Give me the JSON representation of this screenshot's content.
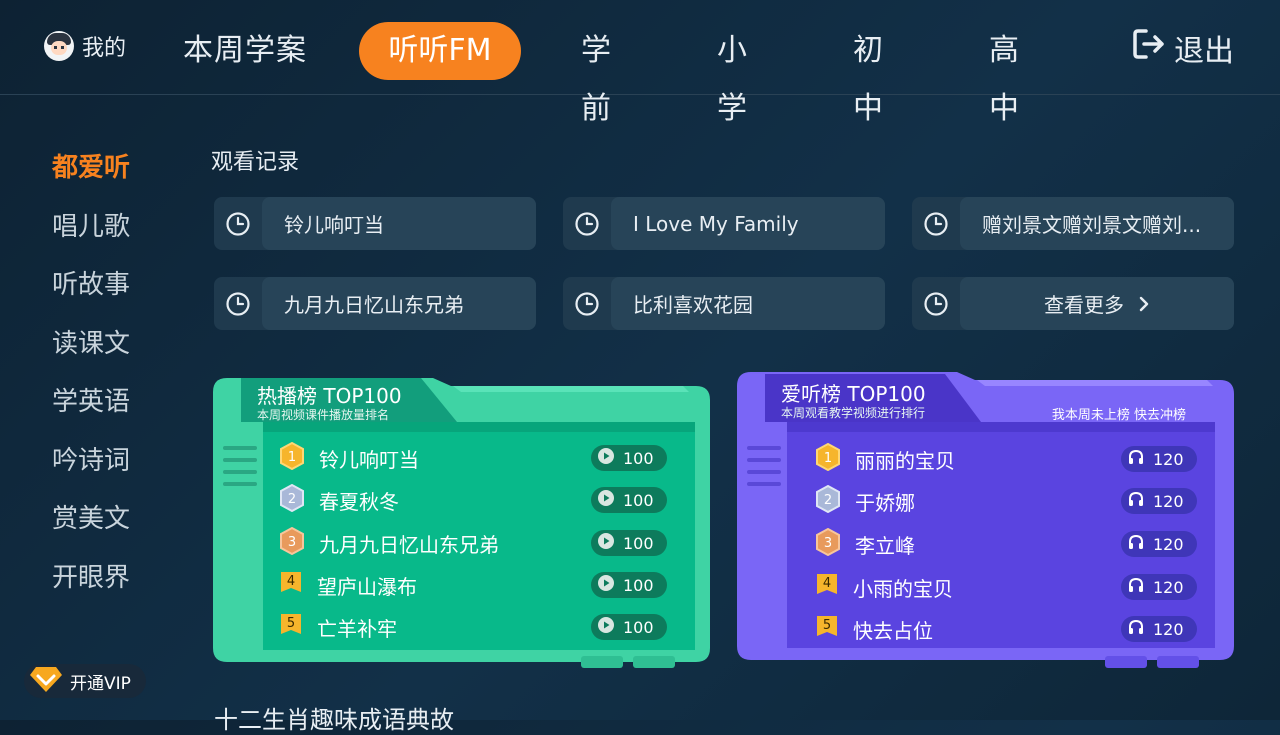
{
  "header": {
    "profile_label": "我的",
    "tabs": [
      {
        "label": "本周学案"
      },
      {
        "label": "听听FM"
      },
      {
        "label": "学前"
      },
      {
        "label": "小学"
      },
      {
        "label": "初中"
      },
      {
        "label": "高中"
      }
    ],
    "active_tab": "听听FM",
    "logout_label": "退出"
  },
  "sidebar": {
    "items": [
      {
        "label": "都爱听"
      },
      {
        "label": "唱儿歌"
      },
      {
        "label": "听故事"
      },
      {
        "label": "读课文"
      },
      {
        "label": "学英语"
      },
      {
        "label": "吟诗词"
      },
      {
        "label": "赏美文"
      },
      {
        "label": "开眼界"
      }
    ],
    "active_item": "都爱听"
  },
  "history": {
    "title": "观看记录",
    "items": [
      {
        "label": "铃儿响叮当"
      },
      {
        "label": "I Love My Family"
      },
      {
        "label": "赠刘景文赠刘景文赠刘..."
      },
      {
        "label": "九月九日忆山东兄弟"
      },
      {
        "label": "比利喜欢花园"
      }
    ],
    "more_label": "查看更多"
  },
  "hot_chart": {
    "title": "热播榜 TOP100",
    "subtitle": "本周视频课件播放量排名",
    "color": "#3dd4a6",
    "rows": [
      {
        "rank": "1",
        "name": "铃儿响叮当",
        "count": "100"
      },
      {
        "rank": "2",
        "name": "春夏秋冬",
        "count": "100"
      },
      {
        "rank": "3",
        "name": "九月九日忆山东兄弟",
        "count": "100"
      },
      {
        "rank": "4",
        "name": "望庐山瀑布",
        "count": "100"
      },
      {
        "rank": "5",
        "name": "亡羊补牢",
        "count": "100"
      }
    ]
  },
  "love_chart": {
    "title": "爱听榜 TOP100",
    "subtitle": "本周观看教学视频进行排行",
    "note": "我本周未上榜 快去冲榜",
    "color": "#7b66f5",
    "rows": [
      {
        "rank": "1",
        "name": "丽丽的宝贝",
        "count": "120"
      },
      {
        "rank": "2",
        "name": "于娇娜",
        "count": "120"
      },
      {
        "rank": "3",
        "name": "李立峰",
        "count": "120"
      },
      {
        "rank": "4",
        "name": "小雨的宝贝",
        "count": "120"
      },
      {
        "rank": "5",
        "name": "快去占位",
        "count": "120"
      }
    ]
  },
  "vip": {
    "label": "开通VIP"
  },
  "next_section_title": "十二生肖趣味成语典故",
  "colors": {
    "accent": "#f7821f",
    "background": "#0f2638"
  }
}
